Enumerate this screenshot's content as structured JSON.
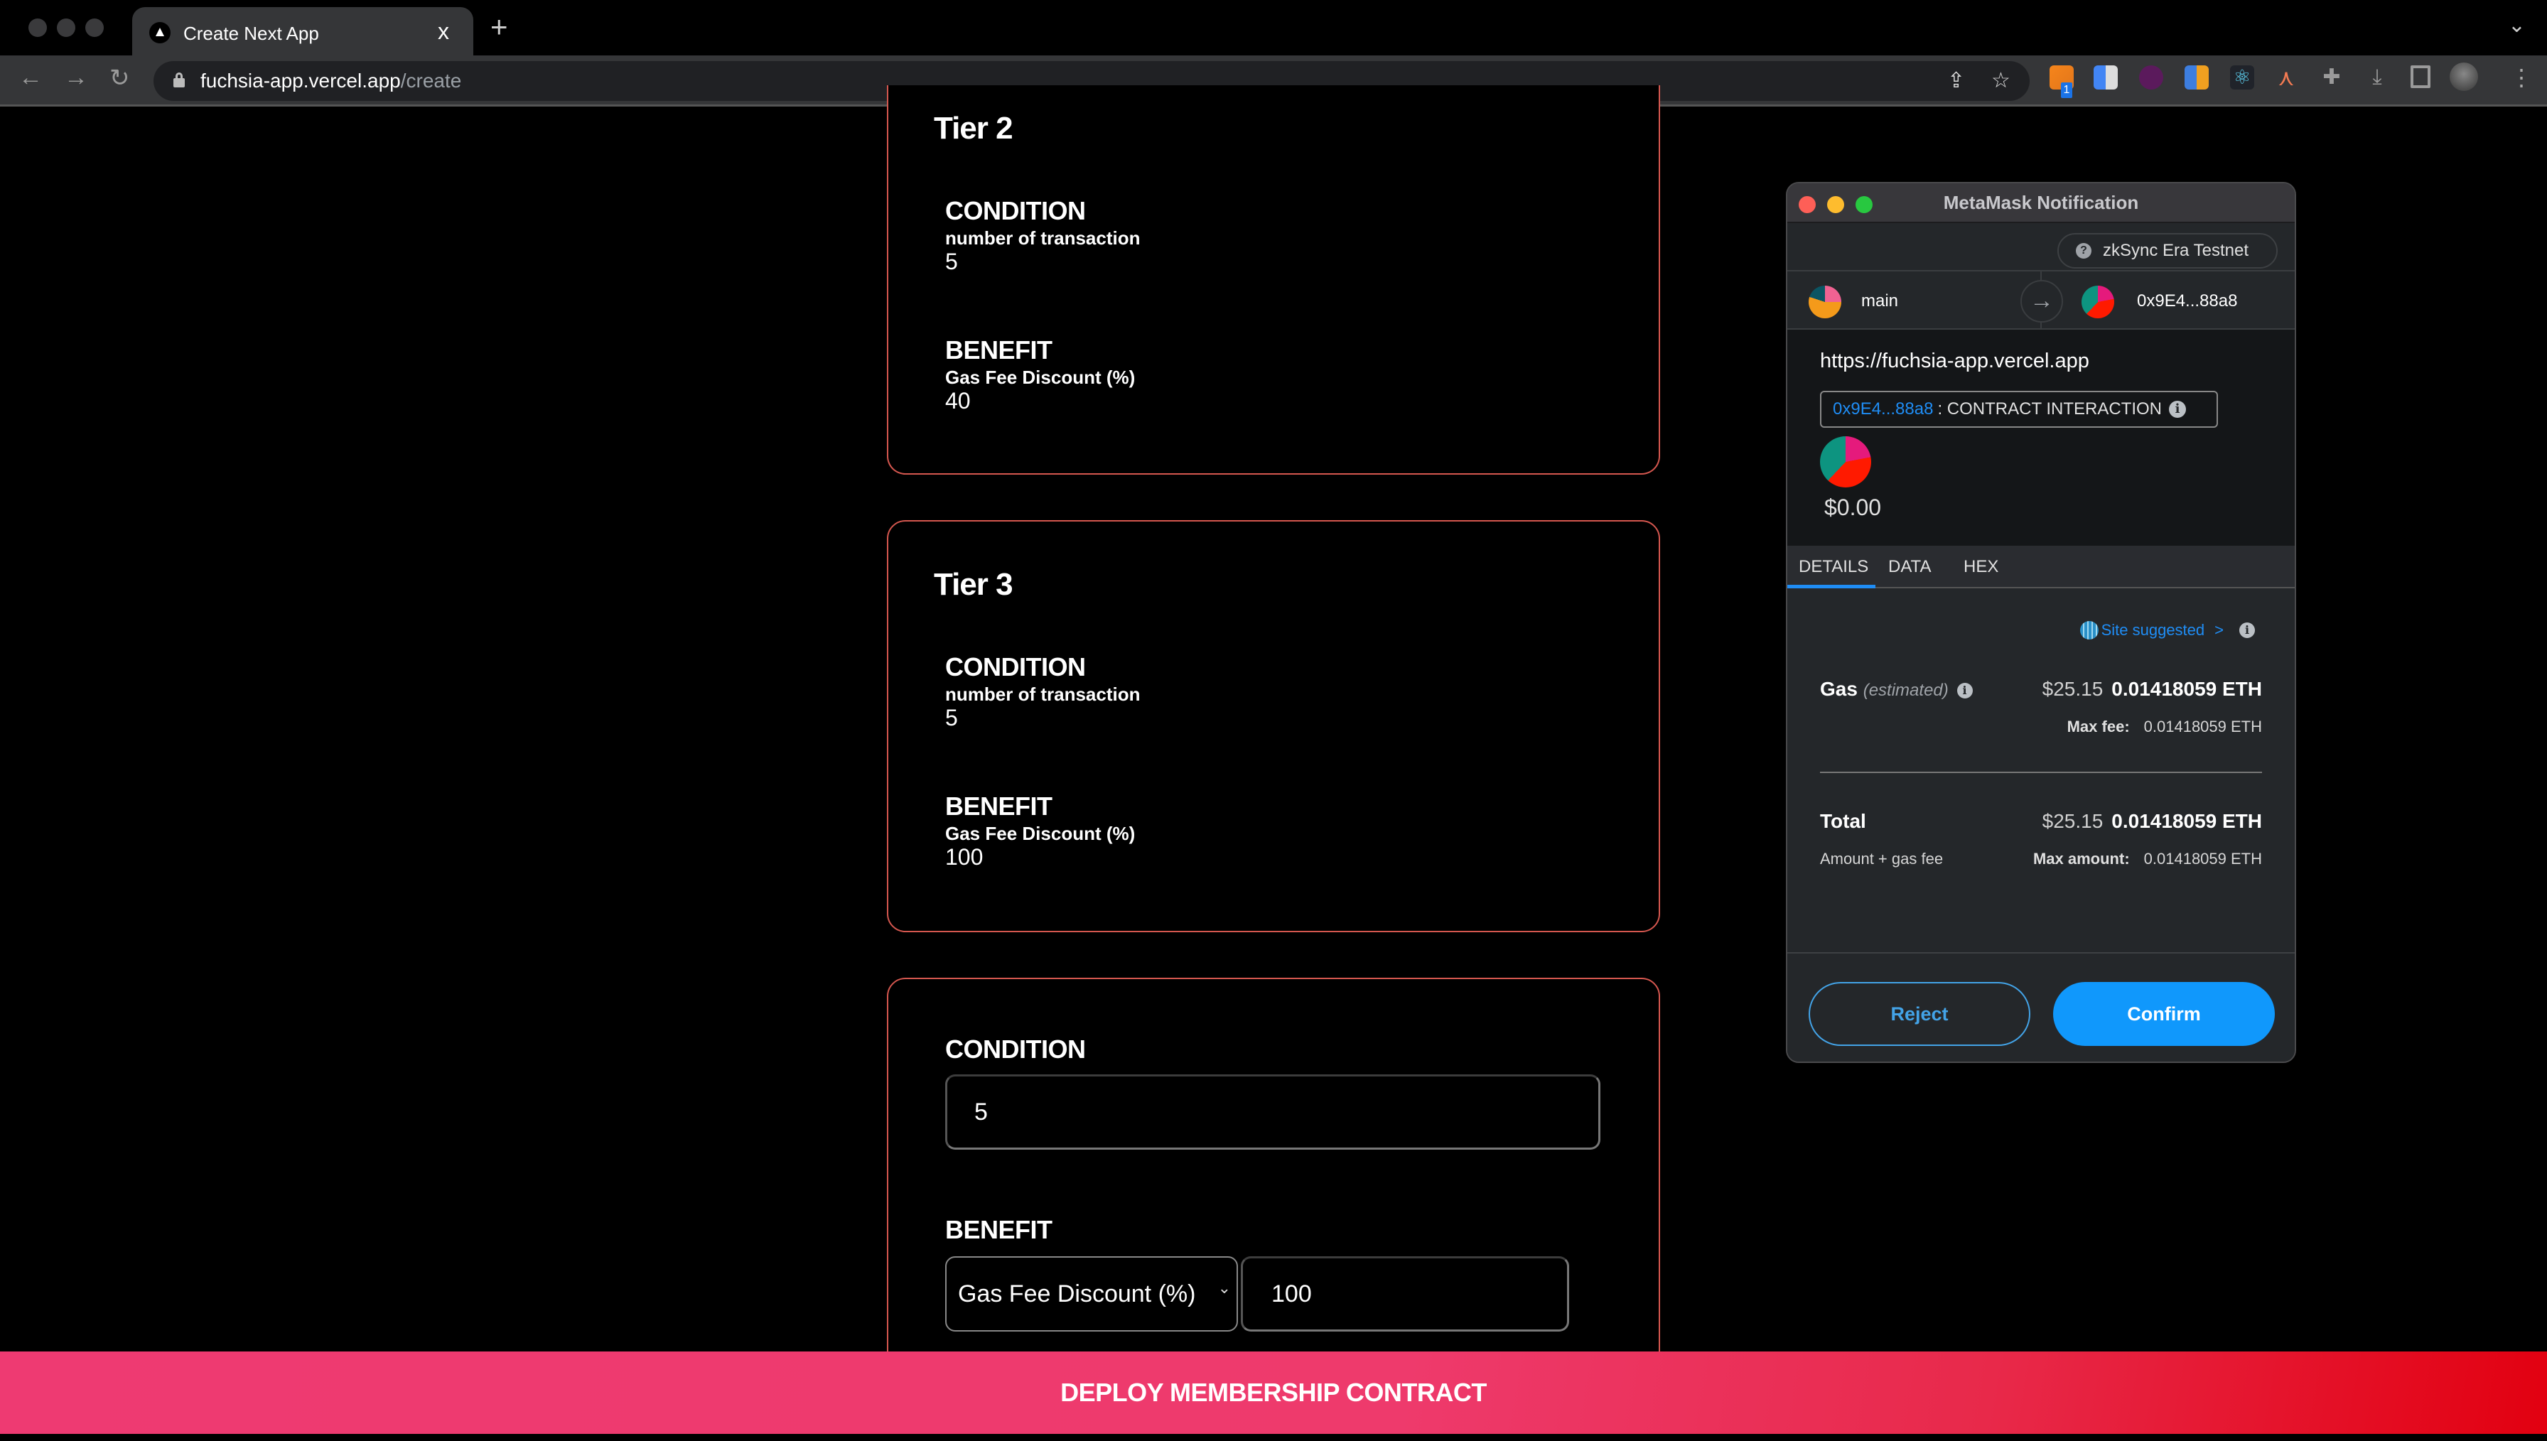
{
  "browser": {
    "tab_title": "Create Next App",
    "tab_close": "x",
    "new_tab": "+",
    "tabs_menu": "⌄",
    "url_host": "fuchsia-app.vercel.app",
    "url_path": "/create",
    "nav": {
      "back": "←",
      "forward": "→",
      "reload": "↻"
    },
    "share_icon": "⇪",
    "star_icon": "☆",
    "extension_badge": "1",
    "extensions": [
      "metamask-fox",
      "google-translate",
      "sign-download",
      "brain",
      "react-devtools",
      "ai-sparkle",
      "puzzle",
      "download",
      "sidebar"
    ],
    "menu_icon": "⋮"
  },
  "page": {
    "tiers": [
      {
        "title": "Tier 2",
        "condition_heading": "CONDITION",
        "condition_type": "number of transaction",
        "condition_value": "5",
        "benefit_heading": "BENEFIT",
        "benefit_type": "Gas Fee Discount (%)",
        "benefit_value": "40"
      },
      {
        "title": "Tier 3",
        "condition_heading": "CONDITION",
        "condition_type": "number of transaction",
        "condition_value": "5",
        "benefit_heading": "BENEFIT",
        "benefit_type": "Gas Fee Discount (%)",
        "benefit_value": "100"
      }
    ],
    "new_tier": {
      "condition_heading": "CONDITION",
      "condition_value": "5",
      "benefit_heading": "BENEFIT",
      "benefit_select": "Gas Fee Discount (%)",
      "benefit_value": "100"
    },
    "deploy_button": "DEPLOY MEMBERSHIP CONTRACT"
  },
  "metamask": {
    "window_title": "MetaMask Notification",
    "network": "zkSync Era Testnet",
    "network_icon": "?",
    "from_account": "main",
    "to_account": "0x9E4...88a8",
    "arrow": "→",
    "origin": "https://fuchsia-app.vercel.app",
    "contract_address": "0x9E4...88a8",
    "contract_label": ": CONTRACT INTERACTION",
    "amount": "$0.00",
    "tabs": [
      "DETAILS",
      "DATA",
      "HEX"
    ],
    "active_tab": "DETAILS",
    "site_suggested": "Site suggested",
    "site_suggested_chevron": ">",
    "gas": {
      "label": "Gas",
      "estimated": "(estimated)",
      "usd": "$25.15",
      "eth": "0.01418059 ETH",
      "max_fee_label": "Max fee:",
      "max_fee_value": "0.01418059 ETH"
    },
    "total": {
      "label": "Total",
      "sublabel": "Amount + gas fee",
      "usd": "$25.15",
      "eth": "0.01418059 ETH",
      "max_amount_label": "Max amount:",
      "max_amount_value": "0.01418059 ETH"
    },
    "reject_label": "Reject",
    "confirm_label": "Confirm",
    "accent_color": "#1098fc"
  }
}
